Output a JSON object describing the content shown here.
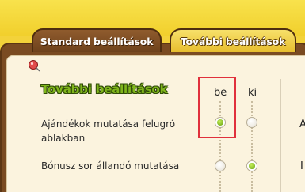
{
  "tabs": [
    {
      "label": "Standard beállítások",
      "active": false
    },
    {
      "label": "További beállítások",
      "active": true
    }
  ],
  "section": {
    "title": "További beállítások"
  },
  "columns": {
    "on_label": "be",
    "off_label": "ki"
  },
  "settings": [
    {
      "label": "Ajándékok mutatása felugró ablakban",
      "selected": "be"
    },
    {
      "label": "Bónusz sor állandó mutatása",
      "selected": "ki"
    }
  ],
  "right_column": {
    "row1_char": "A",
    "row2_char": "I"
  },
  "colors": {
    "accent_green": "#7fb51c",
    "highlight_red": "#e0303c",
    "tab_active": "#f7e06a",
    "tab_inactive": "#8f5b2d"
  }
}
